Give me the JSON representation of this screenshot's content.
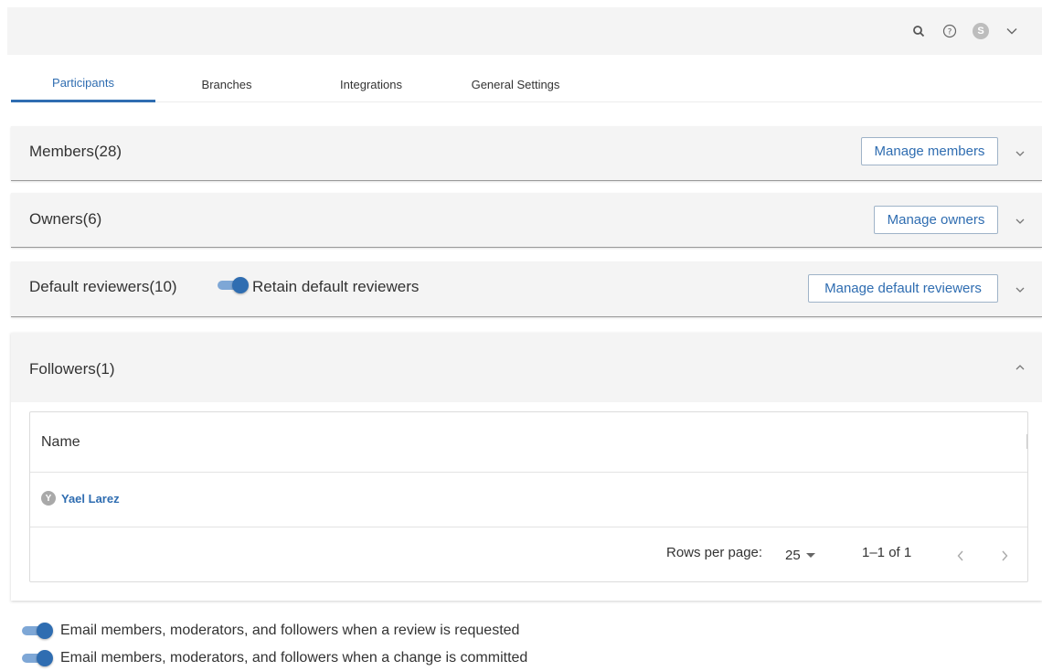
{
  "header": {
    "icons": [
      "search-icon",
      "help-icon",
      "user-avatar",
      "chevron-down-icon"
    ],
    "avatar_initial": "S"
  },
  "tabs": [
    {
      "label": "Participants",
      "active": true
    },
    {
      "label": "Branches",
      "active": false
    },
    {
      "label": "Integrations",
      "active": false
    },
    {
      "label": "General Settings",
      "active": false
    }
  ],
  "panels": {
    "members": {
      "title": "Members(28)",
      "button": "Manage members"
    },
    "owners": {
      "title": "Owners(6)",
      "button": "Manage owners"
    },
    "default_reviewers": {
      "title": "Default reviewers(10)",
      "toggle_label": "Retain default reviewers",
      "toggle_on": true,
      "button": "Manage default reviewers"
    },
    "followers": {
      "title": "Followers(1)",
      "table": {
        "column": "Name",
        "rows": [
          {
            "initial": "Y",
            "name": "Yael Larez"
          }
        ]
      },
      "pagination": {
        "rows_per_page_label": "Rows per page:",
        "rows_per_page_value": "25",
        "range": "1–1 of 1"
      }
    }
  },
  "notifications": [
    {
      "label": "Email members, moderators, and followers when a review is requested",
      "on": true
    },
    {
      "label": "Email members, moderators, and followers when a change is committed",
      "on": true
    }
  ],
  "colors": {
    "accent": "#2f6db1",
    "panel_bg": "#f4f4f4",
    "toggle_track": "#7ea7d6"
  }
}
